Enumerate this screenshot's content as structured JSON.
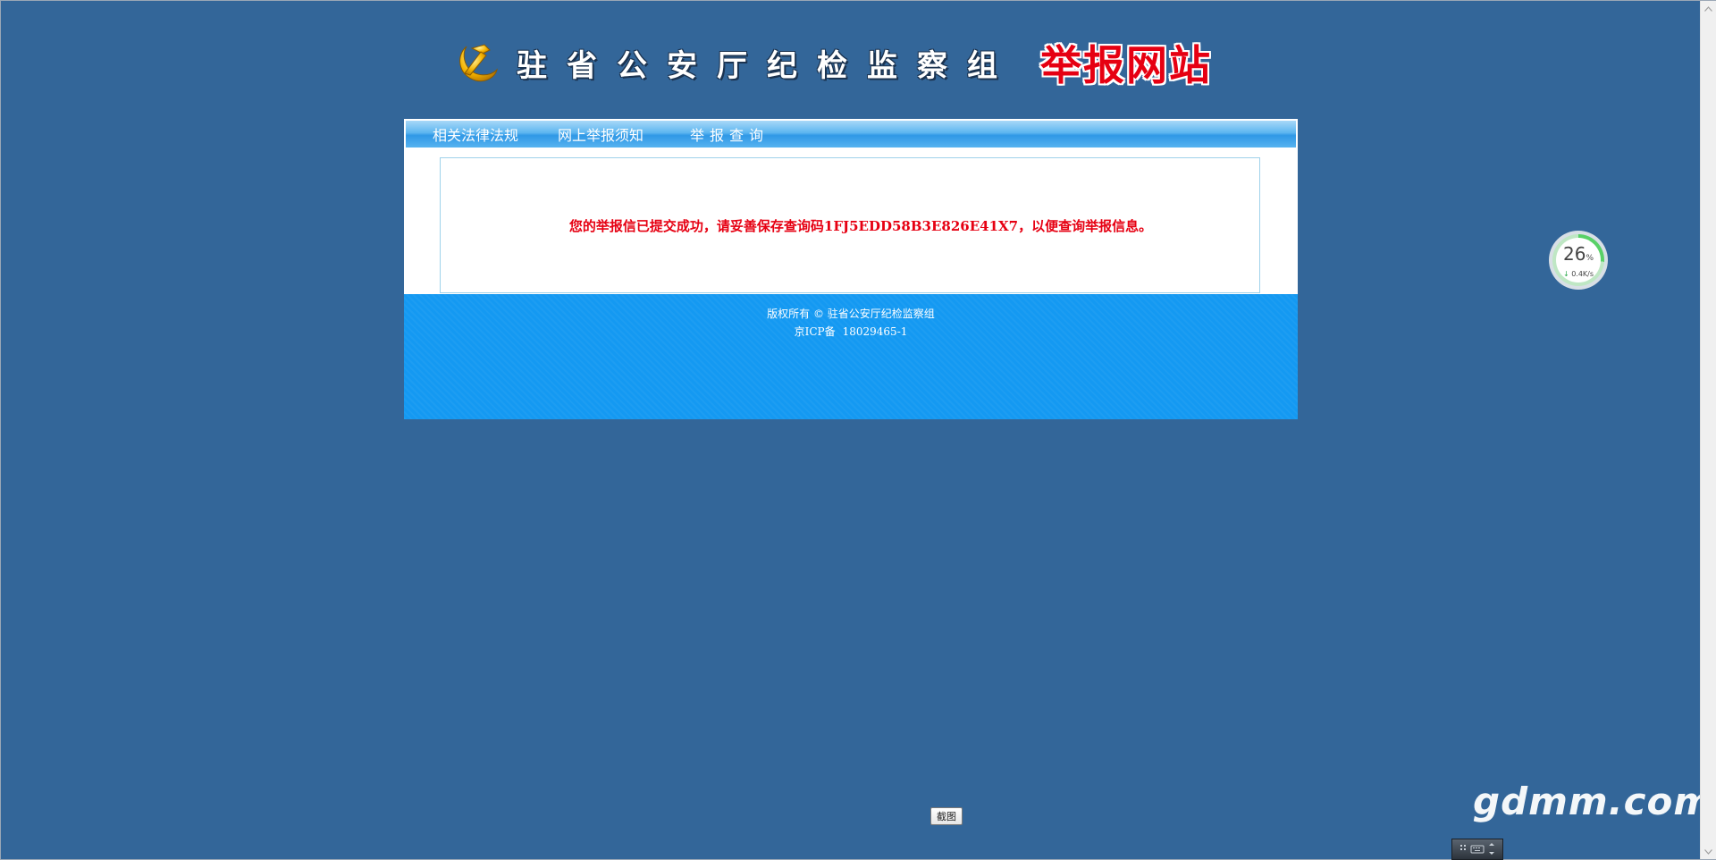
{
  "header": {
    "org_title": "驻省公安厅纪检监察组",
    "site_title": "举报网站"
  },
  "nav": {
    "items": [
      {
        "label": "相关法律法规"
      },
      {
        "label": "网上举报须知"
      },
      {
        "label": "举报查询"
      }
    ]
  },
  "message": {
    "text": "您的举报信已提交成功，请妥善保存查询码1FJ5EDD58B3E826E41X7，以便查询举报信息。"
  },
  "footer": {
    "copyright": "版权所有 © 驻省公安厅纪检监察组",
    "icp_label": "京ICP备",
    "icp_number": "18029465-1"
  },
  "speed_widget": {
    "percent": "26",
    "percent_unit": "%",
    "rate": "0.4K/s",
    "level": 0.26
  },
  "screenshot_button": {
    "label": "截图"
  },
  "watermark": {
    "text": "gdmm.com"
  },
  "colors": {
    "background": "#336699",
    "nav_blue": "#2f98e6",
    "footer_blue": "#1499f2",
    "message_red": "#e60012"
  }
}
